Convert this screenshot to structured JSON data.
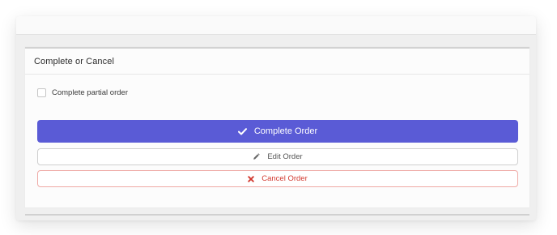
{
  "panel": {
    "title": "Complete or Cancel",
    "checkbox": {
      "label": "Complete partial order",
      "checked": false
    },
    "buttons": {
      "complete": {
        "label": "Complete Order",
        "icon": "checkmark-icon",
        "color": "#5a5bd6"
      },
      "edit": {
        "label": "Edit Order",
        "icon": "pencil-icon"
      },
      "cancel": {
        "label": "Cancel Order",
        "icon": "x-icon",
        "color": "#d23a30"
      }
    }
  }
}
